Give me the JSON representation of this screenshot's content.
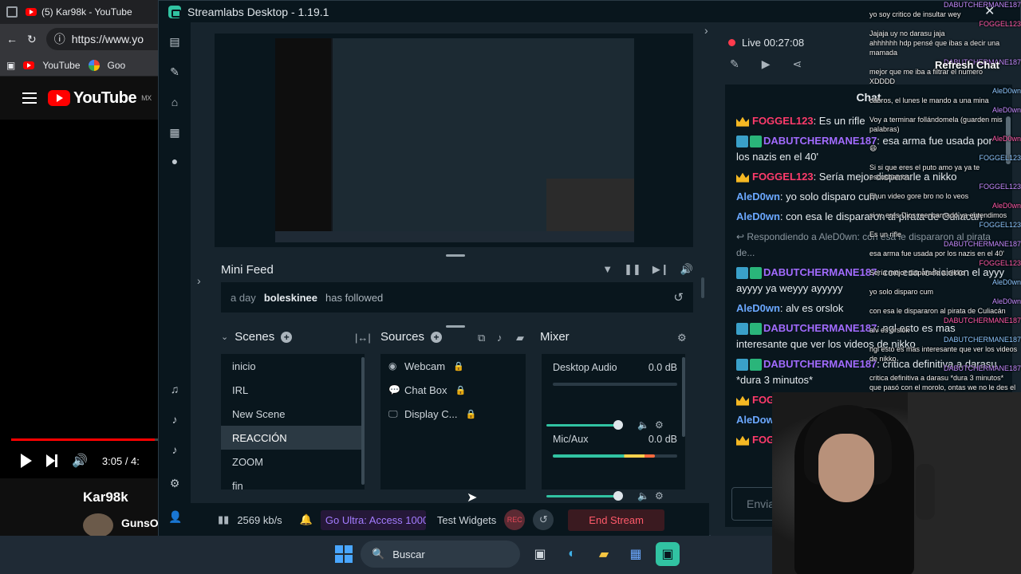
{
  "browser": {
    "tab_title": "(5) Kar98k - YouTube",
    "url": "https://www.yo",
    "bookmarks": [
      "YouTube",
      "Goo"
    ],
    "logo_text": "YouTube",
    "logo_region": "MX",
    "video_time": "3:05 / 4:",
    "progress_fraction": 0.97,
    "video_title": "Kar98k",
    "channel": "GunsO"
  },
  "streamlabs": {
    "window_title": "Streamlabs Desktop - 1.19.1",
    "minifeed": {
      "title": "Mini Feed",
      "entry": {
        "ago": "a day",
        "user": "boleskinee",
        "action": "has followed"
      }
    },
    "scenes": {
      "title": "Scenes",
      "items": [
        "inicio",
        "IRL",
        "New Scene",
        "REACCIÓN",
        "ZOOM",
        "fin"
      ],
      "active_index": 3
    },
    "sources": {
      "title": "Sources",
      "items": [
        "Webcam",
        "Chat Box",
        "Display C..."
      ]
    },
    "mixer": {
      "title": "Mixer",
      "channels": [
        {
          "name": "Desktop Audio",
          "db": "0.0 dB",
          "level": 0.0
        },
        {
          "name": "Mic/Aux",
          "db": "0.0 dB",
          "level": 0.82
        }
      ]
    },
    "footer": {
      "bitrate": "2569 kb/s",
      "go_ultra": "Go Ultra: Access 1000",
      "test_widgets": "Test Widgets",
      "rec": "REC",
      "end_stream": "End Stream"
    },
    "dock": {
      "live_time": "Live 00:27:08",
      "chat_title": "Chat",
      "messages": [
        {
          "user": "FOGGEL123",
          "badge": "crown",
          "text": ": Es un rifle"
        },
        {
          "user": "DABUTCHERMANE187",
          "badge": "boxes",
          "text": ": esa arma fue usada por los nazis en el 40'"
        },
        {
          "user": "FOGGEL123",
          "badge": "crown",
          "text": ": Sería mejor dispararle a nikko"
        },
        {
          "user": "AleD0wn",
          "badge": "",
          "text": ": yo solo disparo cum"
        },
        {
          "user": "AleD0wn",
          "badge": "",
          "text": ": con esa le dispararon al pirata de Culiacán"
        },
        {
          "reply": "Respondiendo a AleD0wn: con esa le dispararon al pirata de..."
        },
        {
          "user": "DABUTCHERMANE187",
          "badge": "boxes",
          "text": ": con esa le hicieron el ayyy ayyyy ya weyyy ayyyyy"
        },
        {
          "user": "AleD0wn",
          "badge": "",
          "text": ": alv es orslok"
        },
        {
          "user": "DABUTCHERMANE187",
          "badge": "boxes",
          "text": ": ngl esto es mas interesante que ver los videos de nikko"
        },
        {
          "user": "DABUTCHERMANE187",
          "badge": "boxes",
          "text": ": critica definitiva a darasu *dura 3 minutos*"
        },
        {
          "user": "FOG",
          "badge": "crown",
          "text": ""
        },
        {
          "user": "AleDow",
          "badge": "",
          "text": ""
        },
        {
          "user": "FOG",
          "badge": "crown",
          "text": ""
        }
      ],
      "input_placeholder": "Envia"
    }
  },
  "overlay_chat": {
    "refresh_label": "Refresh Chat",
    "lines": [
      {
        "n": "DABUTCHERMANE187",
        "t": "yo soy critico de insultar wey"
      },
      {
        "n": "FOGGEL123",
        "t": "Jajaja uy no darasu jaja"
      },
      {
        "n": "",
        "t": "ahhhhhh hdp pensé que ibas a decir una mamada"
      },
      {
        "n": "DABUTCHERMANE187",
        "t": "mejor que me iba a filtrar el numero"
      },
      {
        "n": "",
        "t": "XDDDD"
      },
      {
        "n": "AleD0wn",
        "t": "cabros, el lunes le mando a una mina"
      },
      {
        "n": "AleD0wn",
        "t": "Voy a terminar follándomela (guarden mis palabras)"
      },
      {
        "n": "AleD0wn",
        "t": "😄"
      },
      {
        "n": "FOGGEL123",
        "t": "Si si que eres el puto amo ya ya te escuchamos"
      },
      {
        "n": "FOGGEL123",
        "t": "El un video gore bro no lo veos"
      },
      {
        "n": "AleD0wn",
        "t": "si w, eres Dios reencarnado ya entendimos"
      },
      {
        "n": "FOGGEL123",
        "t": "Es un rifle"
      },
      {
        "n": "DABUTCHERMANE187",
        "t": "esa arma fue usada por los nazis en el 40'"
      },
      {
        "n": "FOGGEL123",
        "t": "Sería mejor dispararle a nikko"
      },
      {
        "n": "AleD0wn",
        "t": "yo solo disparo cum"
      },
      {
        "n": "AleD0wn",
        "t": "con esa le dispararon al pirata de Culiacán"
      },
      {
        "n": "DABUTCHERMANE187",
        "t": "alv es orslok"
      },
      {
        "n": "DABUTCHERMANE187",
        "t": "ngl esto es mas interesante que ver los videos de nikko"
      },
      {
        "n": "DABUTCHERMANE187",
        "t": "critica definitiva a darasu *dura 3 minutos*"
      },
      {
        "n": "",
        "t": "que pasó con el morolo, ontas we no le des el cuatro a darasu"
      }
    ]
  },
  "taskbar": {
    "search_label": "Buscar"
  }
}
